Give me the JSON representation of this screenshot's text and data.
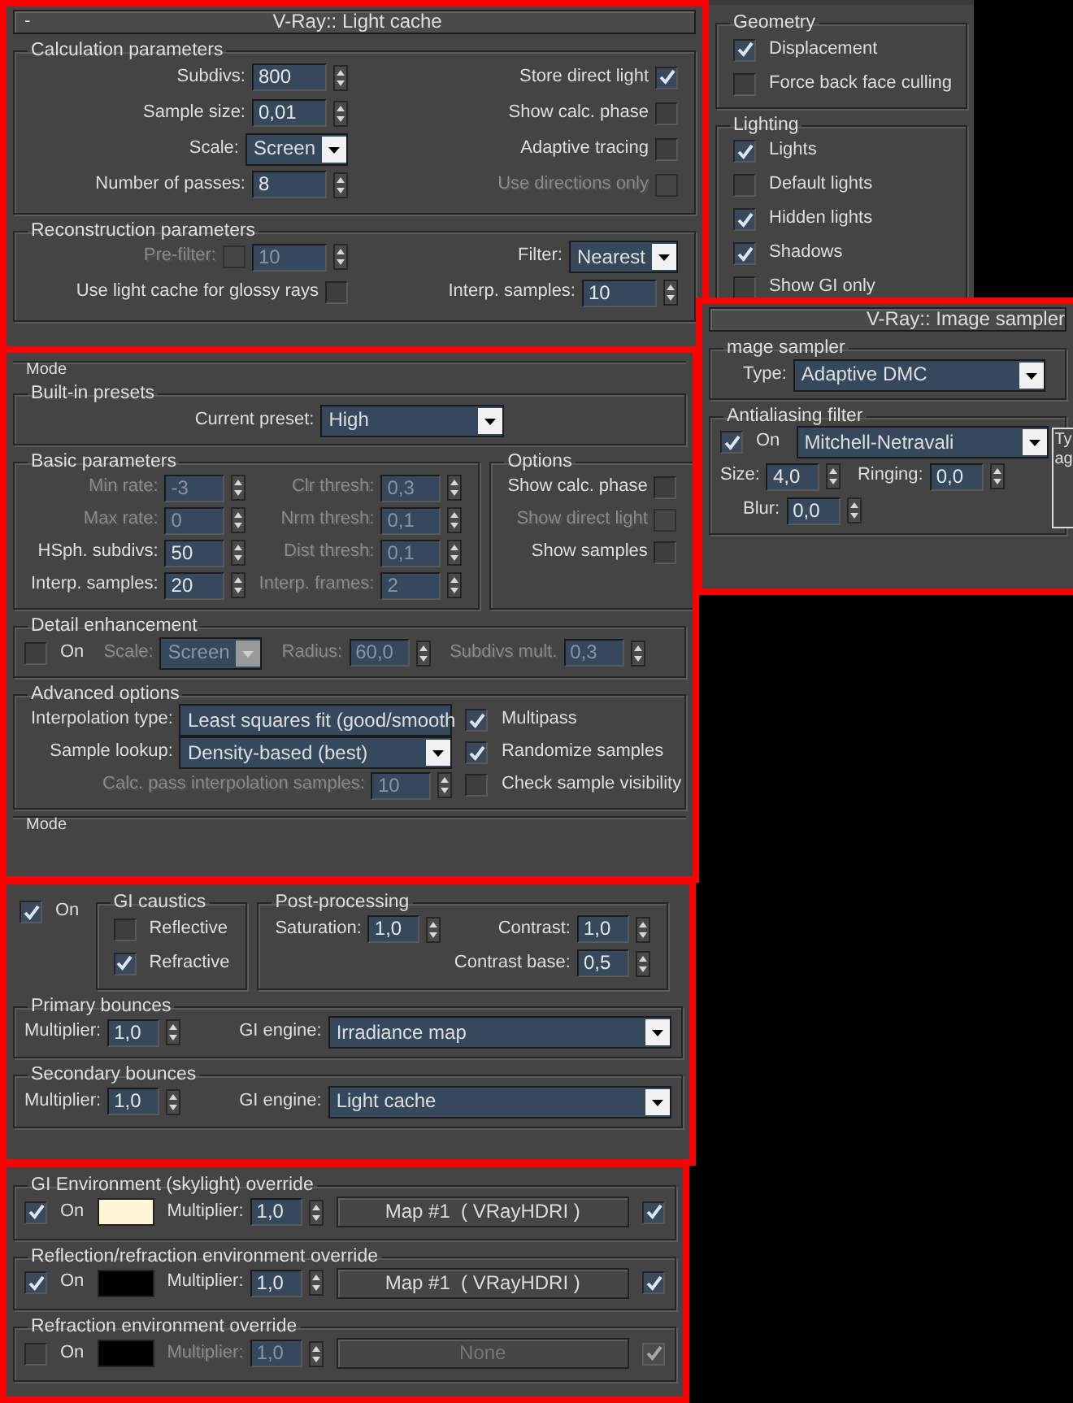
{
  "panels": [
    {
      "highlighted": true,
      "header": {
        "toggle": "-",
        "title": "V-Ray:: Light cache"
      },
      "groups": [
        {
          "kind": "group",
          "legend": "Calculation parameters",
          "columns": [
            [
              {
                "kind": "spinner",
                "label": "Subdivs:",
                "value": "800"
              },
              {
                "kind": "spinner",
                "label": "Sample size:",
                "value": "0,01"
              },
              {
                "kind": "dropdown",
                "label": "Scale:",
                "value": "Screen"
              },
              {
                "kind": "spinner",
                "label": "Number of passes:",
                "value": "8"
              }
            ],
            [
              {
                "kind": "toggle",
                "label": "Store direct light",
                "checked": true
              },
              {
                "kind": "toggle",
                "label": "Show calc. phase",
                "checked": false
              },
              {
                "kind": "toggle",
                "label": "Adaptive tracing",
                "checked": false
              },
              {
                "kind": "toggle",
                "label": "Use directions only",
                "checked": false,
                "disabled": true
              }
            ]
          ]
        },
        {
          "kind": "group",
          "legend": "Reconstruction parameters",
          "columns": [
            [
              {
                "kind": "checkspin",
                "label": "Pre-filter:",
                "checked": false,
                "value": "10",
                "disabled": true
              },
              {
                "kind": "toggle",
                "label": "Use light cache for glossy rays",
                "checked": false
              }
            ],
            [
              {
                "kind": "dropdown",
                "label": "Filter:",
                "value": "Nearest"
              },
              {
                "kind": "spinner",
                "label": "Interp. samples:",
                "value": "10"
              }
            ]
          ]
        }
      ]
    },
    {
      "highlighted": false,
      "groups": [
        {
          "kind": "group",
          "legend": "Geometry",
          "columns": [
            [
              {
                "kind": "checkbox",
                "label": "Displacement",
                "checked": true
              },
              {
                "kind": "checkbox",
                "label": "Force back face culling",
                "checked": false
              }
            ]
          ]
        },
        {
          "kind": "group",
          "legend": "Lighting",
          "columns": [
            [
              {
                "kind": "checkbox",
                "label": "Lights",
                "checked": true
              },
              {
                "kind": "checkbox",
                "label": "Default lights",
                "checked": false
              },
              {
                "kind": "checkbox",
                "label": "Hidden lights",
                "checked": true
              },
              {
                "kind": "checkbox",
                "label": "Shadows",
                "checked": true
              },
              {
                "kind": "checkbox",
                "label": "Show GI only",
                "checked": false
              }
            ]
          ]
        }
      ]
    },
    {
      "highlighted": true,
      "header": {
        "title": "V-Ray:: Image sampler"
      },
      "groups": [
        {
          "kind": "group",
          "legend": "mage sampler",
          "rows": [
            [
              {
                "kind": "combo",
                "label": "Type:",
                "value": "Adaptive DMC"
              }
            ]
          ]
        },
        {
          "kind": "group",
          "legend": "Antialiasing filter",
          "rows": [
            [
              {
                "kind": "checkbox",
                "label": "On",
                "checked": true
              },
              {
                "kind": "combo",
                "value": "Mitchell-Netravali"
              },
              {
                "kind": "note",
                "lines": [
                  "Ty",
                  "ag"
                ]
              }
            ],
            [
              {
                "kind": "spinner",
                "label": "Size:",
                "value": "4,0"
              },
              {
                "kind": "spinner",
                "label": "Ringing:",
                "value": "0,0"
              }
            ],
            [
              {
                "kind": "spinner",
                "label": "Blur:",
                "value": "0,0"
              }
            ]
          ]
        }
      ]
    },
    {
      "highlighted": true,
      "groups": [
        {
          "kind": "cut",
          "legend": "Mode"
        },
        {
          "kind": "group",
          "legend": "Built-in presets",
          "rows": [
            [
              {
                "kind": "dropdown",
                "label": "Current preset:",
                "value": "High"
              }
            ]
          ]
        },
        {
          "kind": "pair",
          "groups": [
            {
              "kind": "group",
              "legend": "Basic parameters",
              "columns": [
                [
                  {
                    "kind": "spinner",
                    "label": "Min rate:",
                    "value": "-3",
                    "disabled": true
                  },
                  {
                    "kind": "spinner",
                    "label": "Max rate:",
                    "value": "0",
                    "disabled": true
                  },
                  {
                    "kind": "spinner",
                    "label": "HSph. subdivs:",
                    "value": "50"
                  },
                  {
                    "kind": "spinner",
                    "label": "Interp. samples:",
                    "value": "20"
                  }
                ],
                [
                  {
                    "kind": "spinner",
                    "label": "Clr thresh:",
                    "value": "0,3",
                    "disabled": true
                  },
                  {
                    "kind": "spinner",
                    "label": "Nrm thresh:",
                    "value": "0,1",
                    "disabled": true
                  },
                  {
                    "kind": "spinner",
                    "label": "Dist thresh:",
                    "value": "0,1",
                    "disabled": true
                  },
                  {
                    "kind": "spinner",
                    "label": "Interp. frames:",
                    "value": "2",
                    "disabled": true
                  }
                ]
              ]
            },
            {
              "kind": "group",
              "legend": "Options",
              "columns": [
                [
                  {
                    "kind": "toggle",
                    "label": "Show calc. phase",
                    "checked": false
                  },
                  {
                    "kind": "toggle",
                    "label": "Show direct light",
                    "checked": false,
                    "disabled": true
                  },
                  {
                    "kind": "toggle",
                    "label": "Show samples",
                    "checked": false
                  }
                ]
              ]
            }
          ]
        },
        {
          "kind": "group",
          "legend": "Detail enhancement",
          "rows": [
            [
              {
                "kind": "checkbox",
                "label": "On",
                "checked": false
              },
              {
                "kind": "dropdown",
                "label": "Scale:",
                "value": "Screen",
                "disabled": true
              },
              {
                "kind": "spinner",
                "label": "Radius:",
                "value": "60,0",
                "disabled": true
              },
              {
                "kind": "spinner",
                "label": "Subdivs mult.",
                "value": "0,3",
                "disabled": true
              }
            ]
          ]
        },
        {
          "kind": "group",
          "legend": "Advanced options",
          "columns": [
            [
              {
                "kind": "combo",
                "label": "Interpolation type:",
                "value": "Least squares fit (good/smooth"
              },
              {
                "kind": "combo",
                "label": "Sample lookup:",
                "value": "Density-based (best)"
              },
              {
                "kind": "spinner",
                "label": "Calc. pass interpolation samples:",
                "value": "10",
                "disabled": true
              }
            ],
            [
              {
                "kind": "checkbox",
                "label": "Multipass",
                "checked": true
              },
              {
                "kind": "checkbox",
                "label": "Randomize samples",
                "checked": true
              },
              {
                "kind": "checkbox",
                "label": "Check sample visibility",
                "checked": false
              }
            ]
          ]
        },
        {
          "kind": "cut",
          "legend": "Mode"
        }
      ]
    },
    {
      "highlighted": true,
      "groups": [
        {
          "kind": "pair",
          "groups": [
            {
              "kind": "plain",
              "columns": [
                [
                  {
                    "kind": "checkbox",
                    "label": "On",
                    "checked": true
                  }
                ]
              ]
            },
            {
              "kind": "group",
              "legend": "GI caustics",
              "columns": [
                [
                  {
                    "kind": "checkbox",
                    "label": "Reflective",
                    "checked": false
                  },
                  {
                    "kind": "checkbox",
                    "label": "Refractive",
                    "checked": true
                  }
                ]
              ]
            },
            {
              "kind": "group",
              "legend": "Post-processing",
              "columns": [
                [
                  {
                    "kind": "spinner",
                    "label": "Saturation:",
                    "value": "1,0"
                  }
                ],
                [
                  {
                    "kind": "spinner",
                    "label": "Contrast:",
                    "value": "1,0"
                  },
                  {
                    "kind": "spinner",
                    "label": "Contrast base:",
                    "value": "0,5"
                  }
                ]
              ]
            }
          ]
        },
        {
          "kind": "group",
          "legend": "Primary bounces",
          "rows": [
            [
              {
                "kind": "spinner",
                "label": "Multiplier:",
                "value": "1,0"
              },
              {
                "kind": "combo",
                "label": "GI engine:",
                "value": "Irradiance map"
              }
            ]
          ]
        },
        {
          "kind": "group",
          "legend": "Secondary bounces",
          "rows": [
            [
              {
                "kind": "spinner",
                "label": "Multiplier:",
                "value": "1,0"
              },
              {
                "kind": "combo",
                "label": "GI engine:",
                "value": "Light cache"
              }
            ]
          ]
        }
      ]
    },
    {
      "highlighted": true,
      "groups": [
        {
          "kind": "group",
          "legend": "GI Environment (skylight) override",
          "rows": [
            [
              {
                "kind": "checkbox",
                "label": "On",
                "checked": true
              },
              {
                "kind": "color",
                "color": "#fff6d5"
              },
              {
                "kind": "spinner",
                "label": "Multiplier:",
                "value": "1,0"
              },
              {
                "kind": "button",
                "text": "Map #1  ( VRayHDRI )"
              },
              {
                "kind": "checkbox",
                "checked": true
              }
            ]
          ]
        },
        {
          "kind": "group",
          "legend": "Reflection/refraction environment override",
          "rows": [
            [
              {
                "kind": "checkbox",
                "label": "On",
                "checked": true
              },
              {
                "kind": "color",
                "color": "#000000"
              },
              {
                "kind": "spinner",
                "label": "Multiplier:",
                "value": "1,0"
              },
              {
                "kind": "button",
                "text": "Map #1  ( VRayHDRI )"
              },
              {
                "kind": "checkbox",
                "checked": true
              }
            ]
          ]
        },
        {
          "kind": "group",
          "legend": "Refraction environment override",
          "rows": [
            [
              {
                "kind": "checkbox",
                "label": "On",
                "checked": false
              },
              {
                "kind": "color",
                "color": "#000000"
              },
              {
                "kind": "spinner",
                "label": "Multiplier:",
                "value": "1,0",
                "disabled": true
              },
              {
                "kind": "button",
                "text": "None",
                "disabled": true
              },
              {
                "kind": "checkbox",
                "checked": true,
                "disabled": true
              }
            ]
          ]
        }
      ]
    }
  ]
}
